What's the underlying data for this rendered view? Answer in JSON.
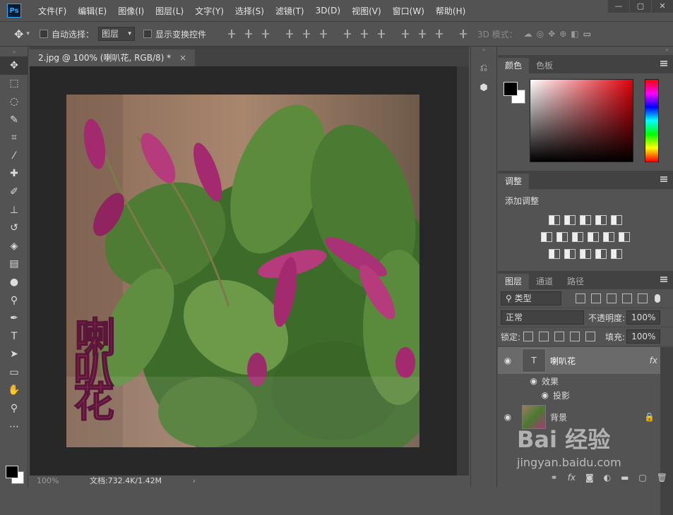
{
  "app": {
    "logo": "Ps"
  },
  "menu": [
    "文件(F)",
    "编辑(E)",
    "图像(I)",
    "图层(L)",
    "文字(Y)",
    "选择(S)",
    "滤镜(T)",
    "3D(D)",
    "视图(V)",
    "窗口(W)",
    "帮助(H)"
  ],
  "window_controls": {
    "minimize": "—",
    "restore": "▢",
    "close": "✕"
  },
  "options": {
    "auto_select_label": "自动选择：",
    "auto_select_value": "图层",
    "show_transform_label": "显示变换控件",
    "mode3d_label": "3D 模式："
  },
  "document": {
    "tab_title": "2.jpg @ 100% (喇叭花, RGB/8) *",
    "close": "×",
    "overlay_text": [
      "喇",
      "叭",
      "花"
    ],
    "status_zoom": "100%",
    "status_doc": "文档:732.4K/1.42M",
    "status_arrow": "›"
  },
  "panels": {
    "color_tabs": [
      "颜色",
      "色板"
    ],
    "adjust_tab": "调整",
    "adjust_title": "添加调整",
    "layers_tabs": [
      "图层",
      "通道",
      "路径"
    ],
    "filter_kind": "类型",
    "blend_mode": "正常",
    "opacity_label": "不透明度:",
    "opacity_value": "100%",
    "lock_label": "锁定:",
    "fill_label": "填充:",
    "fill_value": "100%",
    "layers": [
      {
        "name": "喇叭花",
        "fx": "fx"
      },
      {
        "name": "效果"
      },
      {
        "name": "投影"
      },
      {
        "name": "背景"
      }
    ],
    "bottom_icons": [
      "link-icon",
      "fx-icon",
      "mask-icon",
      "adjustment-icon",
      "group-icon",
      "new-layer-icon",
      "trash-icon"
    ],
    "bottom_fx": "fx"
  },
  "watermark": {
    "brand": "Bai 经验",
    "url": "jingyan.baidu.com"
  },
  "colors": {
    "foreground": "#000000",
    "background": "#ffffff",
    "accent": "#e0000b",
    "text_overlay": "#8e2a58"
  }
}
